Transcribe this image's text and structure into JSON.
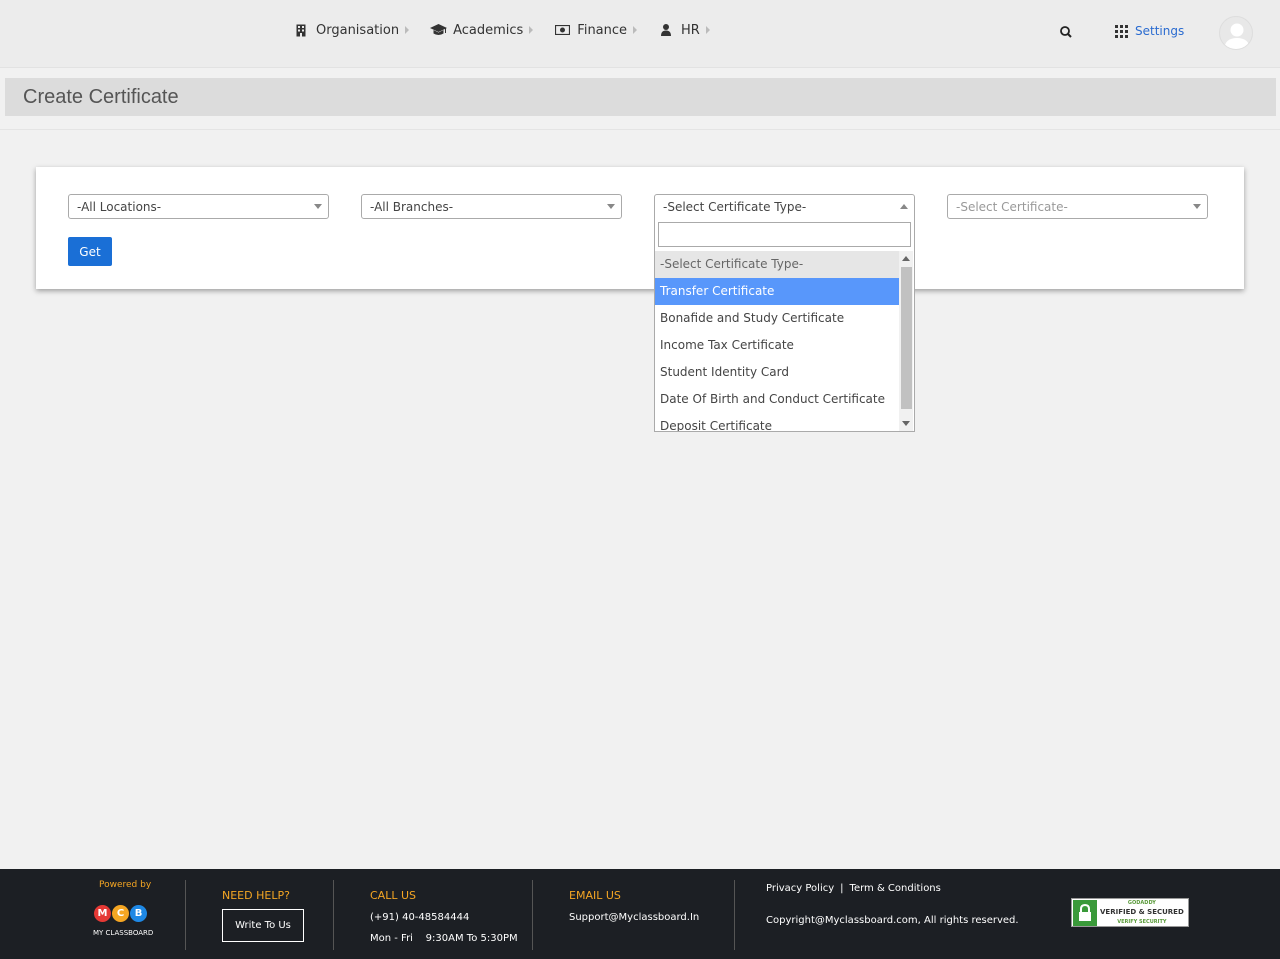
{
  "nav": {
    "items": [
      {
        "label": "Organisation",
        "icon": "building-icon"
      },
      {
        "label": "Academics",
        "icon": "graduation-cap-icon"
      },
      {
        "label": "Finance",
        "icon": "money-icon"
      },
      {
        "label": "HR",
        "icon": "user-icon"
      }
    ],
    "settings_label": "Settings"
  },
  "page": {
    "title": "Create Certificate"
  },
  "filters": {
    "locations": "-All Locations-",
    "branches": "-All Branches-",
    "certificate_type": "-Select Certificate Type-",
    "certificate": "-Select Certificate-",
    "get_label": "Get"
  },
  "dropdown": {
    "search_value": "",
    "options": [
      "-Select Certificate Type-",
      "Transfer Certificate",
      "Bonafide and Study Certificate",
      "Income Tax Certificate",
      "Student Identity Card",
      "Date Of Birth and Conduct Certificate",
      "Deposit Certificate"
    ],
    "highlighted": "Transfer Certificate"
  },
  "footer": {
    "powered_by": "Powered by",
    "logo_letters": [
      "M",
      "C",
      "B"
    ],
    "logo_label": "MY CLASSBOARD",
    "need_help": "NEED HELP?",
    "write_to_us": "Write To Us",
    "call_us": "CALL US",
    "phone": "(+91) 40-48584444",
    "hours": "Mon - Fri    9:30AM To 5:30PM",
    "email_us": "EMAIL US",
    "email": "Support@Myclassboard.In",
    "privacy": "Privacy Policy",
    "link_sep": "|",
    "terms": "Term & Conditions",
    "copyright": "Copyright@Myclassboard.com, All rights reserved.",
    "seal_brand": "GODADDY",
    "seal_main": "VERIFIED & SECURED",
    "seal_sub": "VERIFY SECURITY"
  },
  "colors": {
    "accent": "#1a6fd6",
    "highlight": "#5897fb",
    "footer_bg": "#1c1f24",
    "footer_heading": "#f5a623",
    "logo_m": "#e53935",
    "logo_c": "#f5a623",
    "logo_b": "#1e88e5"
  }
}
